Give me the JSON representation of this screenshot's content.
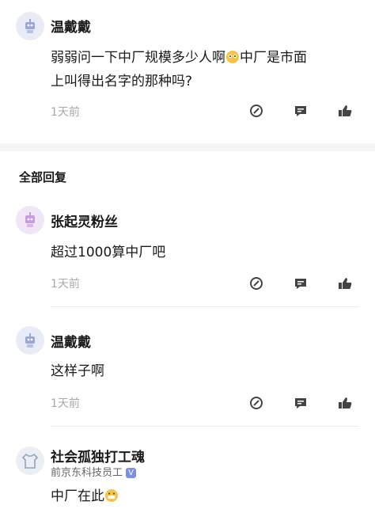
{
  "main_comment": {
    "author": "温戴戴",
    "text_line1": "弱弱问一下中厂规模多少人啊",
    "text_line1b": "中厂是市面",
    "text_line2": "上叫得出名字的那种吗?",
    "time": "1天前"
  },
  "replies_header": "全部回复",
  "replies": [
    {
      "author": "张起灵粉丝",
      "text": "超过1000算中厂吧",
      "time": "1天前"
    },
    {
      "author": "温戴戴",
      "text": "这样子啊",
      "time": "1天前"
    },
    {
      "author": "社会孤独打工魂",
      "subtitle": "前京东科技员工",
      "badge": "V",
      "text": "中厂在此"
    }
  ],
  "icons": {
    "comment": "comment-icon",
    "reply": "reply-icon",
    "like": "thumbs-up-icon",
    "avatar": "robot-avatar-icon"
  },
  "colors": {
    "muted": "#a8a8a8",
    "badge": "#7b8fe5",
    "icon": "#444444"
  }
}
